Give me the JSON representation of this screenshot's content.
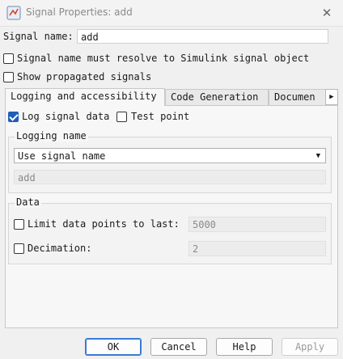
{
  "window": {
    "title": "Signal Properties: add"
  },
  "signal_name": {
    "label": "Signal name:",
    "value": "add"
  },
  "options": {
    "resolve_label": "Signal name must resolve to Simulink signal object",
    "resolve_checked": false,
    "propagated_label": "Show propagated signals",
    "propagated_checked": false
  },
  "tabs": [
    {
      "label": "Logging and accessibility",
      "active": true
    },
    {
      "label": "Code Generation",
      "active": false
    },
    {
      "label": "Documen",
      "active": false
    }
  ],
  "logging": {
    "log_label": "Log signal data",
    "log_checked": true,
    "test_point_label": "Test point",
    "test_point_checked": false,
    "logging_name_group": "Logging name",
    "logging_name_mode": "Use signal name",
    "logging_name_value": "add",
    "data_group": "Data",
    "limit_label": "Limit data points to last:",
    "limit_value": "5000",
    "limit_checked": false,
    "decimation_label": "Decimation:",
    "decimation_value": "2",
    "decimation_checked": false
  },
  "buttons": {
    "ok": "OK",
    "cancel": "Cancel",
    "help": "Help",
    "apply": "Apply"
  },
  "colors": {
    "accent": "#1f5fb8",
    "window_bg": "#f0f0f0"
  }
}
